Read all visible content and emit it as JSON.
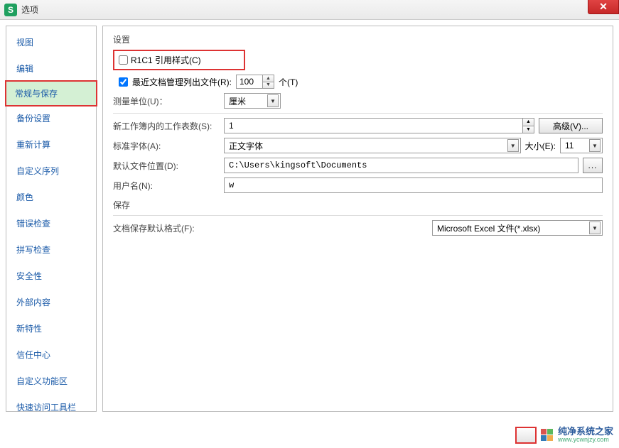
{
  "titlebar": {
    "app_glyph": "S",
    "title": "选项"
  },
  "sidebar": {
    "items": [
      {
        "label": "视图"
      },
      {
        "label": "编辑"
      },
      {
        "label": "常规与保存",
        "active": true
      },
      {
        "label": "备份设置"
      },
      {
        "label": "重新计算"
      },
      {
        "label": "自定义序列"
      },
      {
        "label": "颜色"
      },
      {
        "label": "错误检查"
      },
      {
        "label": "拼写检查"
      },
      {
        "label": "安全性"
      },
      {
        "label": "外部内容"
      },
      {
        "label": "新特性"
      },
      {
        "label": "信任中心"
      },
      {
        "label": "自定义功能区"
      },
      {
        "label": "快速访问工具栏"
      }
    ]
  },
  "settings": {
    "group1_label": "设置",
    "r1c1_label": "R1C1 引用样式(C)",
    "r1c1_checked": false,
    "recent_label": "最近文档管理列出文件(R):",
    "recent_checked": true,
    "recent_value": "100",
    "recent_unit": "个(T)",
    "unit_label": "测量单位(U)：",
    "unit_value": "厘米",
    "sheets_label": "新工作簿内的工作表数(S):",
    "sheets_value": "1",
    "advanced_btn": "高级(V)...",
    "font_label": "标准字体(A):",
    "font_value": "正文字体",
    "size_label": "大小(E):",
    "size_value": "11",
    "default_loc_label": "默认文件位置(D):",
    "default_loc_value": "C:\\Users\\kingsoft\\Documents",
    "browse_label": "...",
    "username_label": "用户名(N):",
    "username_value": "w",
    "group2_label": "保存",
    "save_fmt_label": "文档保存默认格式(F):",
    "save_fmt_value": "Microsoft Excel 文件(*.xlsx)"
  },
  "watermark": {
    "main": "纯净系统之家",
    "sub": "www.ycwnjzy.com"
  }
}
